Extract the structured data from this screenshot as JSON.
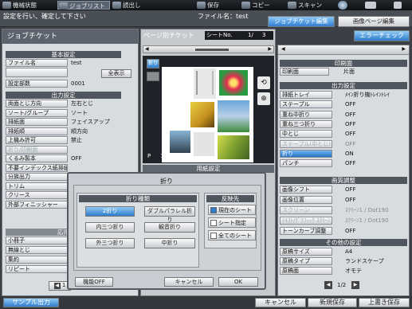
{
  "topmenu": [
    {
      "label": "機械状態",
      "active": false
    },
    {
      "label": "ジョブリスト",
      "active": true
    },
    {
      "label": "読出し",
      "active": false
    },
    {
      "label": "保存",
      "active": false
    },
    {
      "label": "コピー",
      "active": false
    },
    {
      "label": "スキャン",
      "active": false
    },
    {
      "label": "",
      "active": false
    },
    {
      "label": "",
      "active": false
    }
  ],
  "instruction": "設定を行い、確定して下さい",
  "filename_label": "ファイル名：test",
  "tabs": {
    "job_ticket_edit": "ジョブチケット編集",
    "image_page_edit": "画像ページ編集"
  },
  "left": {
    "title": "ジョブチケット",
    "section_basic": "基本設定",
    "filename": {
      "label": "ファイル名",
      "value": "test"
    },
    "show_all": "全表示",
    "copies": {
      "label": "設定部数",
      "value": "0001"
    },
    "section_output": "出力設定",
    "output_rows": [
      {
        "label": "両面とじ方向",
        "value": "左右とじ",
        "disabled": false
      },
      {
        "label": "ソート/グループ",
        "value": "ソート",
        "disabled": false
      },
      {
        "label": "排紙面",
        "value": "フェイスアップ",
        "disabled": false
      },
      {
        "label": "排紙順",
        "value": "順方向",
        "disabled": false
      },
      {
        "label": "上機み許可",
        "value": "禁止",
        "disabled": false
      },
      {
        "label": "折り/印刷面",
        "value": "",
        "disabled": true
      },
      {
        "label": "くるみ製本",
        "value": "OFF",
        "disabled": false
      },
      {
        "label": "不要インデックス紙排紙",
        "value": "",
        "disabled": false
      },
      {
        "label": "分族出力",
        "value": "",
        "disabled": false
      },
      {
        "label": "トリム",
        "value": "",
        "disabled": false
      },
      {
        "label": "クリース",
        "value": "",
        "disabled": false
      },
      {
        "label": "外部フィニッシャー",
        "value": "",
        "disabled": false
      }
    ],
    "section_apply": "応用",
    "apply_rows": [
      {
        "label": "小冊子"
      },
      {
        "label": "無線とじ"
      },
      {
        "label": "集約"
      },
      {
        "label": "リピート"
      }
    ],
    "page": "1"
  },
  "center": {
    "title": "ページ別チケット",
    "sheet_no": "シートNo.",
    "sheet_page": "1/",
    "sheet_total": "3",
    "fold_badge": "折り",
    "page_label": "P",
    "page_num": "1",
    "paper_header": "用紙設定"
  },
  "error_check": "エラーチェック",
  "right": {
    "section_print_side": "印刷面",
    "print_side": {
      "label": "印刷面",
      "value": "片面"
    },
    "section_output": "出力設定",
    "output_rows": [
      {
        "label": "排紙トレイ",
        "value": "ﾒｲﾝ折り機ﾄﾚｲﾝﾄﾚｲ",
        "state": "normal"
      },
      {
        "label": "ステープル",
        "value": "OFF",
        "state": "normal"
      },
      {
        "label": "重ね中折り",
        "value": "OFF",
        "state": "normal"
      },
      {
        "label": "重ね三つ折り",
        "value": "OFF",
        "state": "normal"
      },
      {
        "label": "中とじ",
        "value": "OFF",
        "state": "normal"
      },
      {
        "label": "ステープル(中とじ)",
        "value": "OFF",
        "state": "disabled"
      },
      {
        "label": "折り",
        "value": "ON",
        "state": "highlight"
      },
      {
        "label": "パンチ",
        "value": "OFF",
        "state": "normal"
      }
    ],
    "section_image": "画質調整",
    "image_rows": [
      {
        "label": "画像シフト",
        "value": "OFF",
        "state": "normal"
      },
      {
        "label": "画像位置",
        "value": "OFF",
        "state": "normal"
      },
      {
        "label": "スクリーン",
        "value": "ｽｸﾘｰﾝ1 / Dot190",
        "state": "disabled"
      },
      {
        "label": "ﾃｷｽﾄ/ｸﾞﾗﾌｨｯｸ ｽｸﾘｰﾝ",
        "value": "ｽｸﾘｰﾝ1 / Dot190",
        "state": "disabled"
      },
      {
        "label": "トーンカーブ調整",
        "value": "OFF",
        "state": "normal"
      }
    ],
    "section_other": "その他の設定",
    "other_rows": [
      {
        "label": "原稿サイズ",
        "value": "A4"
      },
      {
        "label": "原稿タイプ",
        "value": "ランドスケープ"
      },
      {
        "label": "原稿面",
        "value": "オモテ"
      }
    ],
    "page": "1/2"
  },
  "dialog": {
    "title": "折り",
    "types_header": "折り種類",
    "types": [
      "2折り",
      "ダブルパラレル折り",
      "内三つ折り",
      "観音折り",
      "外三つ折り",
      "中折り"
    ],
    "selected_type": "2折り",
    "target_header": "反映先",
    "targets": [
      "現在のシート",
      "シート指定",
      "全てのシート"
    ],
    "selected_target": "現在のシート",
    "func_off": "機能OFF",
    "cancel": "キャンセル",
    "ok": "OK"
  },
  "bottom": {
    "sample": "サンプル出力",
    "cancel": "キャンセル",
    "new_save": "新規保存",
    "overwrite": "上書き保存"
  }
}
